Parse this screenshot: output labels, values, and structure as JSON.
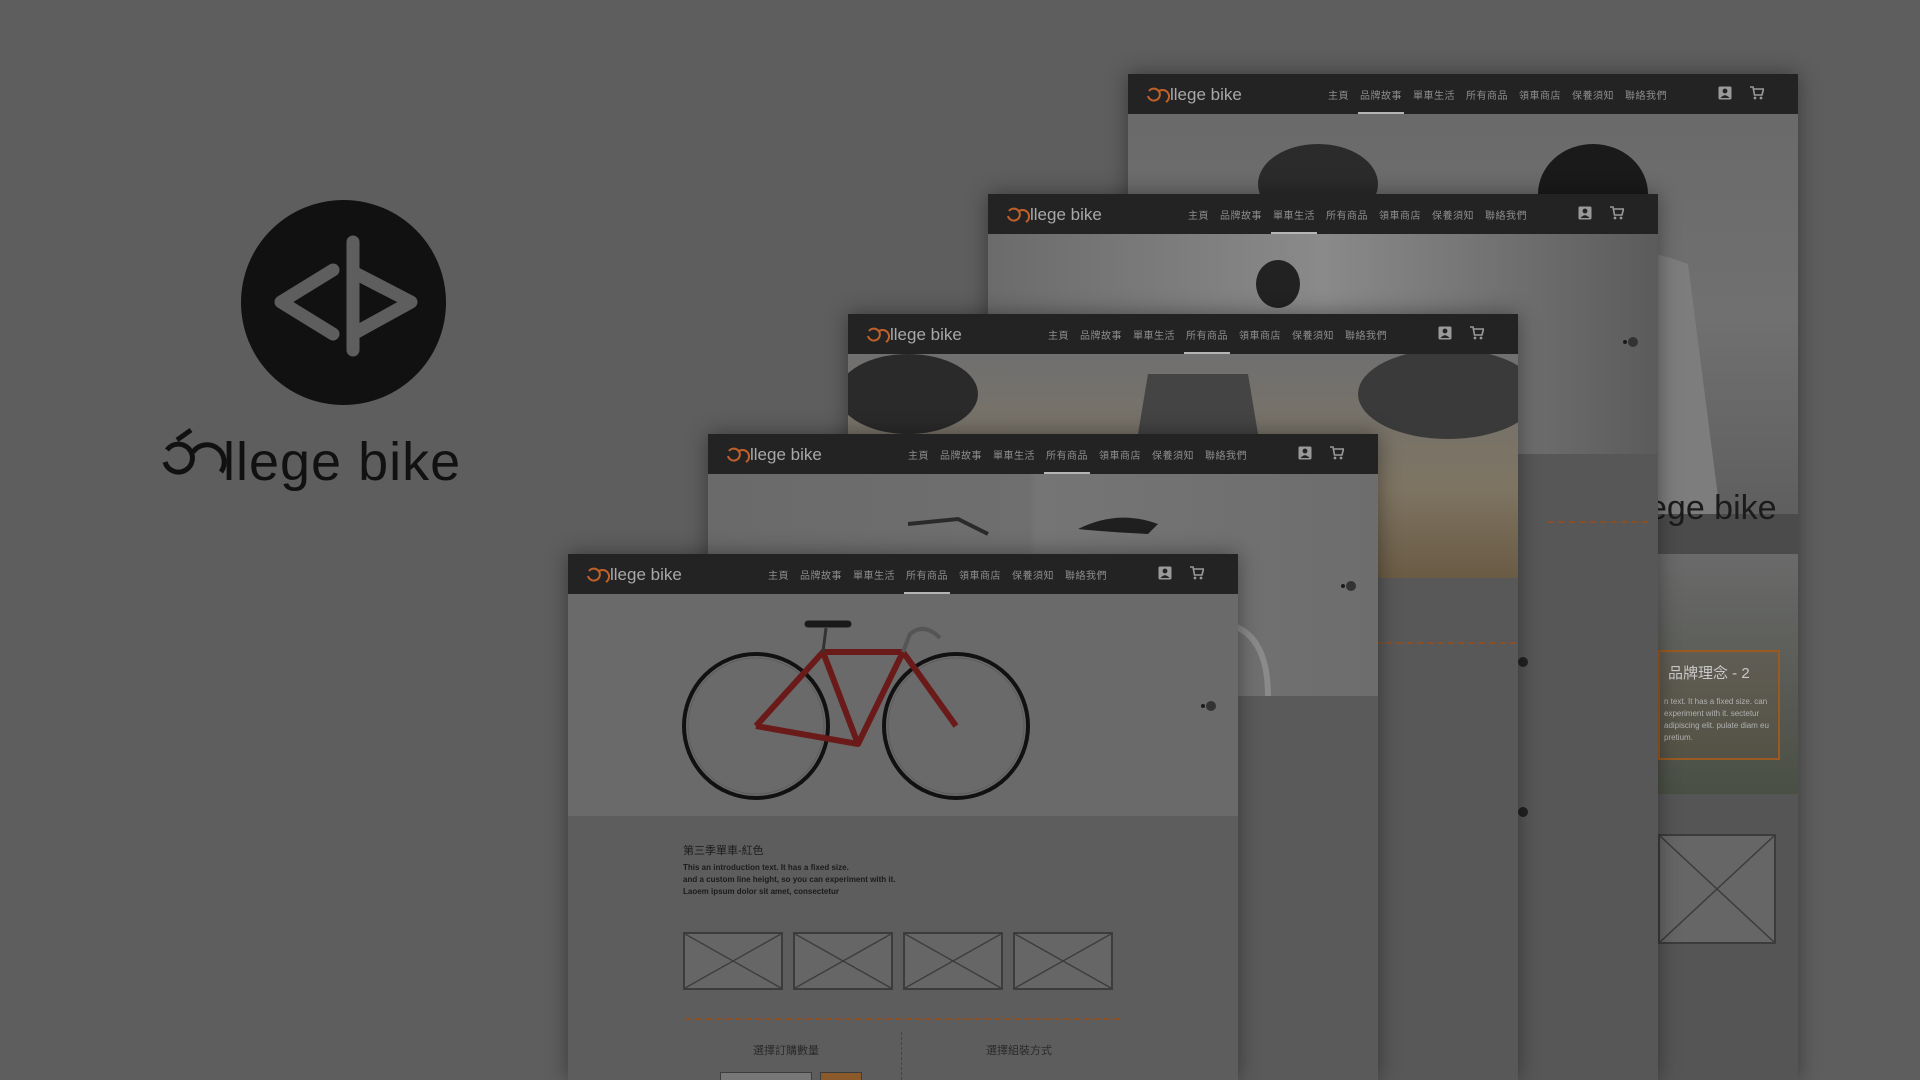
{
  "brand": {
    "name": "college bike",
    "word_display": "cɔllege bike"
  },
  "nav": {
    "logo_text": "llege bike",
    "items": [
      "主頁",
      "品牌故事",
      "單車生活",
      "所有商品",
      "領車商店",
      "保養須知",
      "聯絡我們"
    ]
  },
  "cards": [
    {
      "id": "card-1",
      "active_index": 1
    },
    {
      "id": "card-2",
      "active_index": 2
    },
    {
      "id": "card-3",
      "active_index": 3
    },
    {
      "id": "card-4",
      "active_index": 3
    },
    {
      "id": "card-5",
      "active_index": 3
    }
  ],
  "card1": {
    "overlay_text": "ege bike",
    "box_title": "品牌理念 - 2",
    "box_text": "n text. It has a fixed size. can experiment with it. sectetur adipiscing elit. pulate diam eu pretium."
  },
  "front": {
    "product_title": "第三季單車-紅色",
    "intro_lines": [
      "This an introduction text. It has a fixed size.",
      "and a custom line height, so you can experiment with it.",
      "Laoem ipsum dolor sit amet, consectetur"
    ],
    "select_qty": "選擇訂購數量",
    "select_method": "選擇組裝方式"
  },
  "icons": {
    "account": "account-icon",
    "cart": "cart-icon",
    "carousel_dots": "carousel-dots-icon"
  },
  "colors": {
    "background": "#5e5e5e",
    "nav": "#232323",
    "accent_orange": "#c0612a",
    "bike_red": "#8c1b1b"
  }
}
